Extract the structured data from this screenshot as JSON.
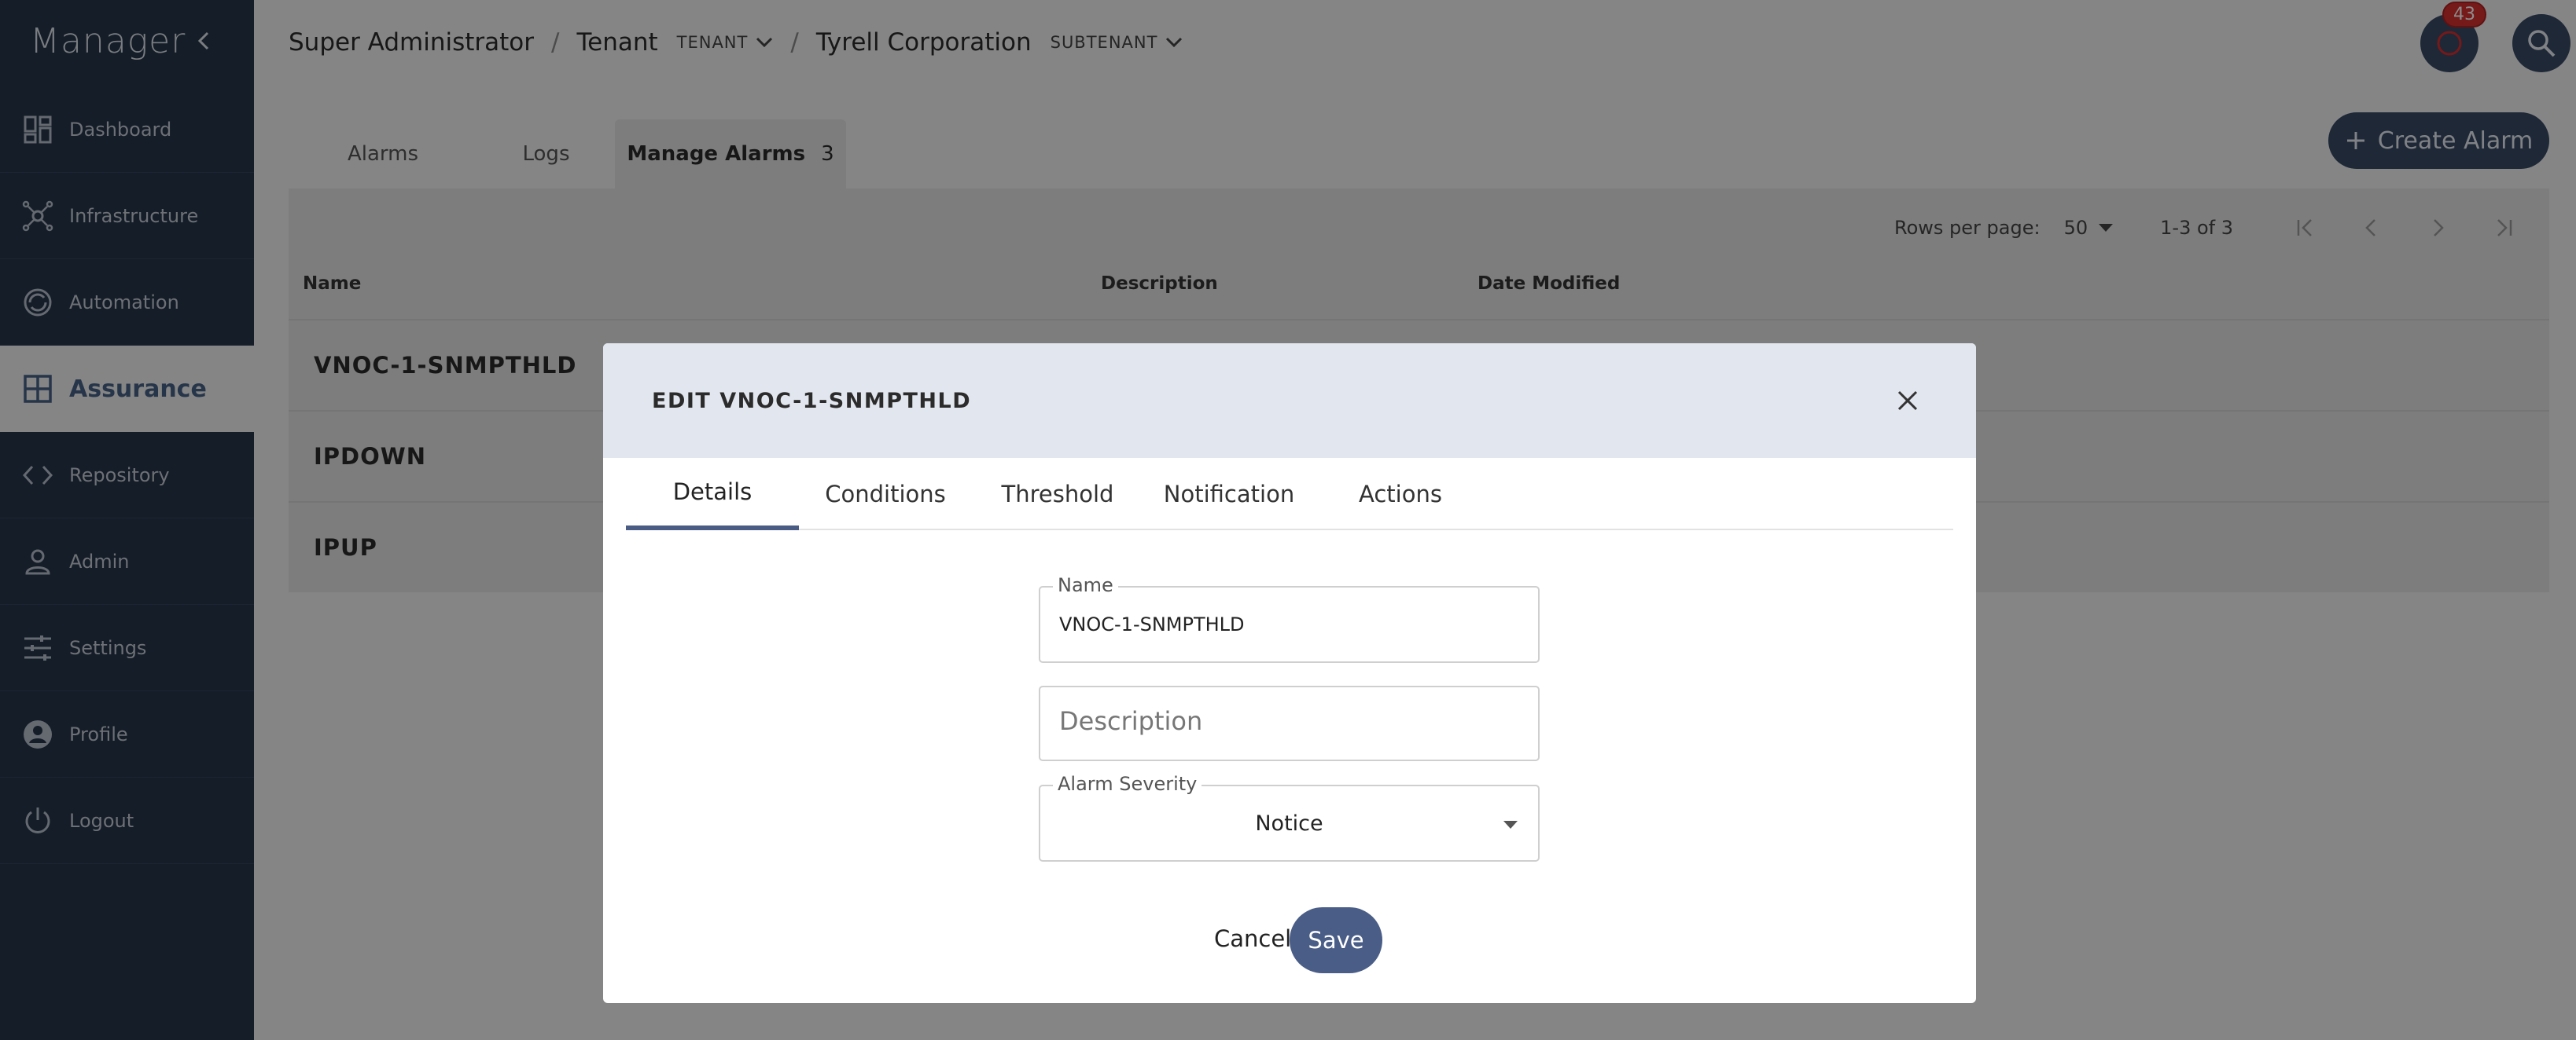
{
  "sidebar": {
    "title": "Manager",
    "items": [
      {
        "label": "Dashboard",
        "icon": "dashboard-icon"
      },
      {
        "label": "Infrastructure",
        "icon": "network-icon"
      },
      {
        "label": "Automation",
        "icon": "automation-icon"
      },
      {
        "label": "Assurance",
        "icon": "grid-icon",
        "active": true
      },
      {
        "label": "Repository",
        "icon": "code-icon"
      },
      {
        "label": "Admin",
        "icon": "person-icon"
      },
      {
        "label": "Settings",
        "icon": "sliders-icon"
      },
      {
        "label": "Profile",
        "icon": "account-circle-icon"
      },
      {
        "label": "Logout",
        "icon": "power-icon"
      }
    ]
  },
  "breadcrumb": {
    "root": "Super Administrator",
    "tenant": "Tenant",
    "tenant_dropdown": "TENANT",
    "org": "Tyrell Corporation",
    "subtenant_dropdown": "SUBTENANT"
  },
  "notifications": {
    "count": "43"
  },
  "main": {
    "tabs": [
      {
        "label": "Alarms"
      },
      {
        "label": "Logs"
      },
      {
        "label": "Manage Alarms",
        "count": "3",
        "active": true
      }
    ],
    "create_button": "Create Alarm",
    "pager": {
      "rows_label": "Rows per page:",
      "rows_value": "50",
      "range": "1-3 of 3"
    },
    "table": {
      "headers": [
        "Name",
        "Description",
        "Date Modified"
      ],
      "rows": [
        {
          "name": "VNOC-1-SNMPTHLD"
        },
        {
          "name": "IPDOWN"
        },
        {
          "name": "IPUP"
        }
      ]
    }
  },
  "modal": {
    "title": "EDIT VNOC-1-SNMPTHLD",
    "tabs": [
      "Details",
      "Conditions",
      "Threshold",
      "Notification",
      "Actions"
    ],
    "active_tab": "Details",
    "fields": {
      "name_label": "Name",
      "name_value": "VNOC-1-SNMPTHLD",
      "description_placeholder": "Description",
      "severity_label": "Alarm Severity",
      "severity_value": "Notice"
    },
    "cancel_label": "Cancel",
    "save_label": "Save"
  },
  "colors": {
    "sidebar_bg": "#263549",
    "accent": "#4a5d87",
    "badge": "#d62f2f"
  }
}
